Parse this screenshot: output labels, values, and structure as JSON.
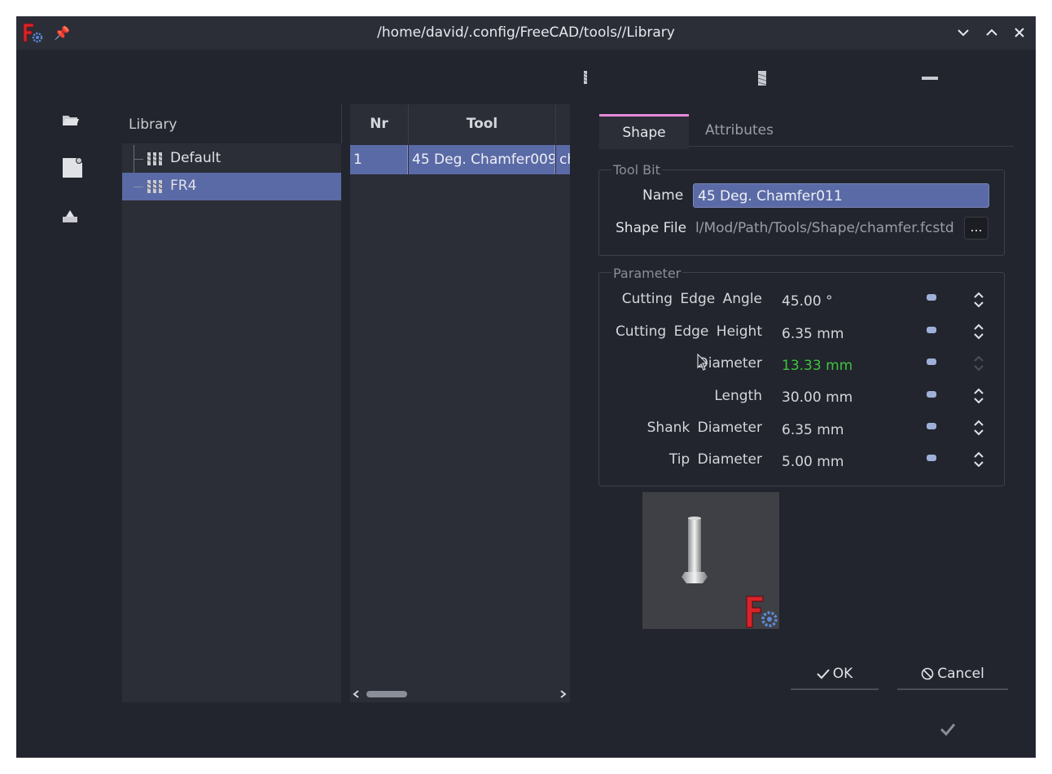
{
  "window": {
    "title": "/home/david/.config/FreeCAD/tools//Library",
    "controls": [
      "chevron-down-icon",
      "chevron-up-icon",
      "close-icon"
    ]
  },
  "library": {
    "header": "Library",
    "items": [
      {
        "label": "Default"
      },
      {
        "label": "FR4"
      }
    ]
  },
  "table": {
    "columns": [
      "Nr",
      "Tool"
    ],
    "rows": [
      {
        "nr": "1",
        "tool": "45 Deg. Chamfer009",
        "extra": "ch"
      }
    ]
  },
  "tabs": [
    {
      "label": "Shape",
      "active": true
    },
    {
      "label": "Attributes",
      "active": false
    }
  ],
  "toolbit": {
    "group_title": "Tool Bit",
    "name_label": "Name",
    "name_value": "45 Deg. Chamfer011",
    "shape_file_label": "Shape File",
    "shape_file_value": "l/Mod/Path/Tools/Shape/chamfer.fcstd",
    "browse_label": "..."
  },
  "parameters": {
    "group_title": "Parameter",
    "items": [
      {
        "label": "Cutting Edge Angle",
        "value": "45.00 °"
      },
      {
        "label": "Cutting Edge Height",
        "value": "6.35 mm"
      },
      {
        "label": "Diameter",
        "value": "13.33 mm",
        "highlight": true
      },
      {
        "label": "Length",
        "value": "30.00 mm"
      },
      {
        "label": "Shank Diameter",
        "value": "6.35 mm"
      },
      {
        "label": "Tip Diameter",
        "value": "5.00 mm"
      }
    ]
  },
  "buttons": {
    "ok": "OK",
    "cancel": "Cancel"
  },
  "colors": {
    "selection": "#5a6aa6",
    "tab_accent": "#e58ad9",
    "modified_value": "#3ec23e"
  }
}
